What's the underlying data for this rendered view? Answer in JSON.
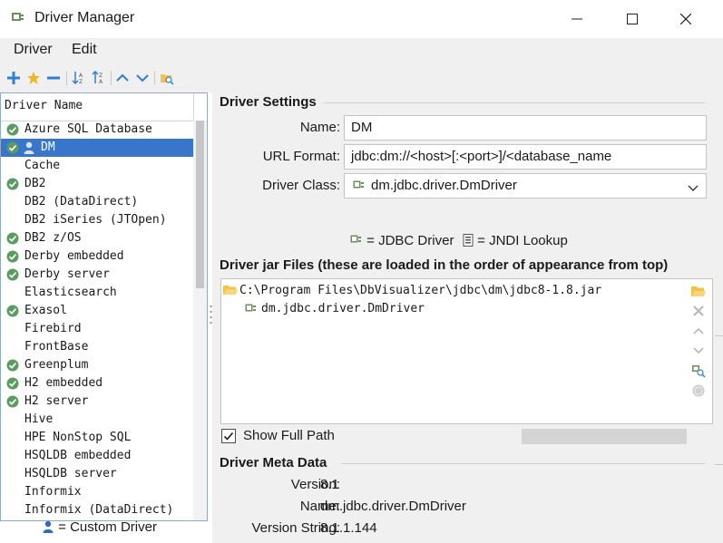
{
  "window": {
    "title": "Driver Manager",
    "icon": "driver-manager-icon",
    "controls": [
      "minimize",
      "maximize",
      "close"
    ]
  },
  "menubar": {
    "items": [
      "Driver",
      "Edit"
    ]
  },
  "toolbar": {
    "icons": [
      "add-icon",
      "star-icon",
      "remove-icon",
      "sort-descending-icon",
      "sort-ascending-icon",
      "move-up-icon",
      "move-down-icon",
      "find-drivers-icon"
    ]
  },
  "driver_list": {
    "header": "Driver Name",
    "selected": "DM",
    "items": [
      {
        "label": "Azure SQL Database",
        "configured": true
      },
      {
        "label": "DM",
        "configured": true,
        "custom": true
      },
      {
        "label": "Cache",
        "configured": false
      },
      {
        "label": "DB2",
        "configured": true
      },
      {
        "label": "DB2 (DataDirect)",
        "configured": false
      },
      {
        "label": "DB2 iSeries (JTOpen)",
        "configured": false
      },
      {
        "label": "DB2 z/OS",
        "configured": true
      },
      {
        "label": "Derby embedded",
        "configured": true
      },
      {
        "label": "Derby server",
        "configured": true
      },
      {
        "label": "Elasticsearch",
        "configured": false
      },
      {
        "label": "Exasol",
        "configured": true
      },
      {
        "label": "Firebird",
        "configured": false
      },
      {
        "label": "FrontBase",
        "configured": false
      },
      {
        "label": "Greenplum",
        "configured": true
      },
      {
        "label": "H2 embedded",
        "configured": true
      },
      {
        "label": "H2 server",
        "configured": true
      },
      {
        "label": "Hive",
        "configured": false
      },
      {
        "label": "HPE NonStop SQL",
        "configured": false
      },
      {
        "label": "HSQLDB embedded",
        "configured": false
      },
      {
        "label": "HSQLDB server",
        "configured": false
      },
      {
        "label": "Informix",
        "configured": false
      },
      {
        "label": "Informix (DataDirect)",
        "configured": false
      }
    ],
    "legend": "= Custom Driver"
  },
  "settings": {
    "section_title": "Driver Settings",
    "name_label": "Name:",
    "name_value": "DM",
    "url_label": "URL Format:",
    "url_value": "jdbc:dm://<host>[:<port>]/<database_name",
    "class_label": "Driver Class:",
    "class_value": "dm.jdbc.driver.DmDriver",
    "legend_jdbc": "= JDBC Driver",
    "legend_jndi": "= JNDI Lookup"
  },
  "jar_files": {
    "section_title": "Driver jar Files (these are loaded in the order of appearance from top)",
    "path": "C:\\Program Files\\DbVisualizer\\jdbc\\dm\\jdbc8-1.8.jar",
    "driver": "dm.jdbc.driver.DmDriver",
    "show_full_path_label": "Show Full Path",
    "show_full_path_checked": true
  },
  "meta": {
    "section_title": "Driver Meta Data",
    "version_label": "Version:",
    "version_value": "8.1",
    "name_label": "Name:",
    "name_value": "dm.jdbc.driver.DmDriver",
    "version_string_label": "Version String:",
    "version_string_value": "8.1.1.144"
  },
  "colors": {
    "selection": "#3876c9",
    "check": "#5b9b62",
    "accent_blue": "#2f7fd0",
    "star": "#f0b429"
  }
}
